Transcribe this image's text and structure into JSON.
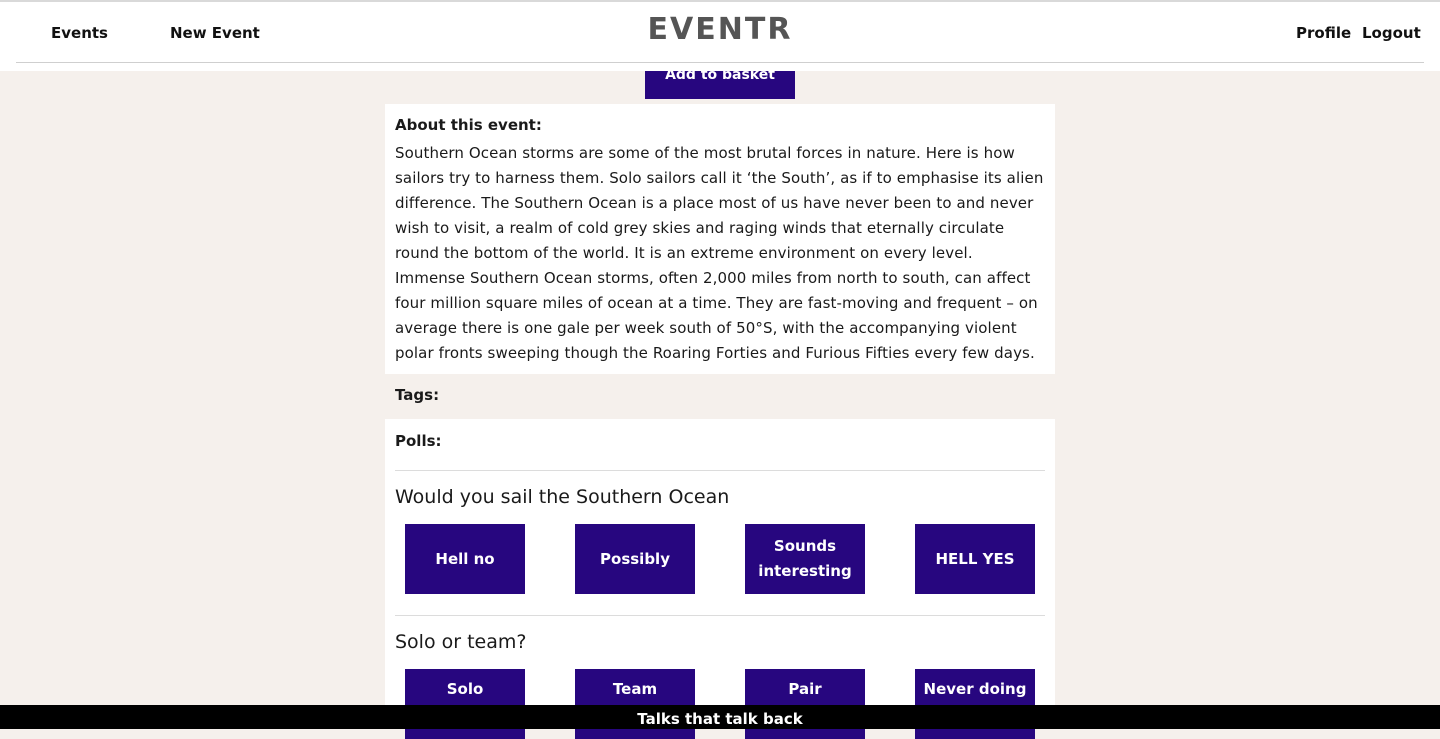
{
  "header": {
    "nav_left": [
      "Events",
      "New Event"
    ],
    "logo": "EVENTR",
    "nav_right": [
      "Profile",
      "Logout"
    ]
  },
  "basket": {
    "label": "Add to basket"
  },
  "about": {
    "heading": "About this event:",
    "text": "Southern Ocean storms are some of the most brutal forces in nature. Here is how sailors try to harness them. Solo sailors call it ‘the South’, as if to emphasise its alien difference. The Southern Ocean is a place most of us have never been to and never wish to visit, a realm of cold grey skies and raging winds that eternally circulate round the bottom of the world. It is an extreme environment on every level. Immense Southern Ocean storms, often 2,000 miles from north to south, can affect four million square miles of ocean at a time. They are fast-moving and frequent – on average there is one gale per week south of 50°S, with the accompanying violent polar fronts sweeping though the Roaring Forties and Furious Fifties every few days."
  },
  "tags": {
    "label": "Tags:"
  },
  "polls": {
    "label": "Polls:",
    "items": [
      {
        "question": "Would you sail the Southern Ocean",
        "options": [
          "Hell no",
          "Possibly",
          "Sounds interesting",
          "HELL YES"
        ]
      },
      {
        "question": "Solo or team?",
        "options": [
          "Solo",
          "Team",
          "Pair",
          "Never doing it"
        ]
      }
    ]
  },
  "footer": {
    "text": "Talks that talk back"
  },
  "colors": {
    "accent": "#27067f",
    "page_bg": "#f5f0ec",
    "footer_bg": "#000000"
  }
}
